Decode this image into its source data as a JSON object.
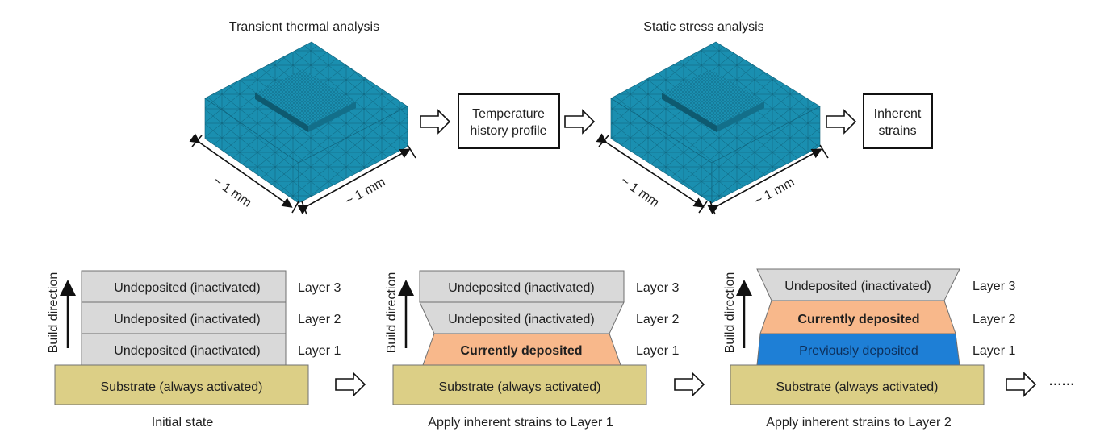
{
  "top_row": {
    "thermal_model": {
      "title": "Transient thermal analysis",
      "dim_left": "~ 1 mm",
      "dim_right": "~ 1 mm"
    },
    "temperature_box": {
      "line1": "Temperature",
      "line2": "history profile"
    },
    "stress_model": {
      "title": "Static stress analysis",
      "dim_left": "~ 1 mm",
      "dim_right": "~ 1 mm"
    },
    "strains_box": {
      "line1": "Inherent",
      "line2": "strains"
    }
  },
  "colors": {
    "mesh": "#1a8fb0",
    "mesh_dark": "#136f8a",
    "undeposited": "#d9d9d9",
    "current": "#f8b88b",
    "previous": "#1e7fd6",
    "substrate": "#dccf86"
  },
  "bottom_row": {
    "build_direction": "Build direction",
    "panels": [
      {
        "caption": "Initial state",
        "substrate": "Substrate (always activated)",
        "layers": [
          {
            "label": "Layer 3",
            "text": "Undeposited (inactivated)",
            "state": "undeposited"
          },
          {
            "label": "Layer 2",
            "text": "Undeposited (inactivated)",
            "state": "undeposited"
          },
          {
            "label": "Layer 1",
            "text": "Undeposited (inactivated)",
            "state": "undeposited"
          }
        ]
      },
      {
        "caption": "Apply inherent strains to Layer 1",
        "substrate": "Substrate (always activated)",
        "layers": [
          {
            "label": "Layer 3",
            "text": "Undeposited (inactivated)",
            "state": "undeposited"
          },
          {
            "label": "Layer 2",
            "text": "Undeposited (inactivated)",
            "state": "undeposited"
          },
          {
            "label": "Layer 1",
            "text": "Currently deposited",
            "state": "current"
          }
        ]
      },
      {
        "caption": "Apply inherent strains to Layer 2",
        "substrate": "Substrate (always activated)",
        "layers": [
          {
            "label": "Layer 3",
            "text": "Undeposited (inactivated)",
            "state": "undeposited"
          },
          {
            "label": "Layer 2",
            "text": "Currently deposited",
            "state": "current"
          },
          {
            "label": "Layer 1",
            "text": "Previously deposited",
            "state": "previous"
          }
        ]
      }
    ],
    "continuation": "······"
  }
}
